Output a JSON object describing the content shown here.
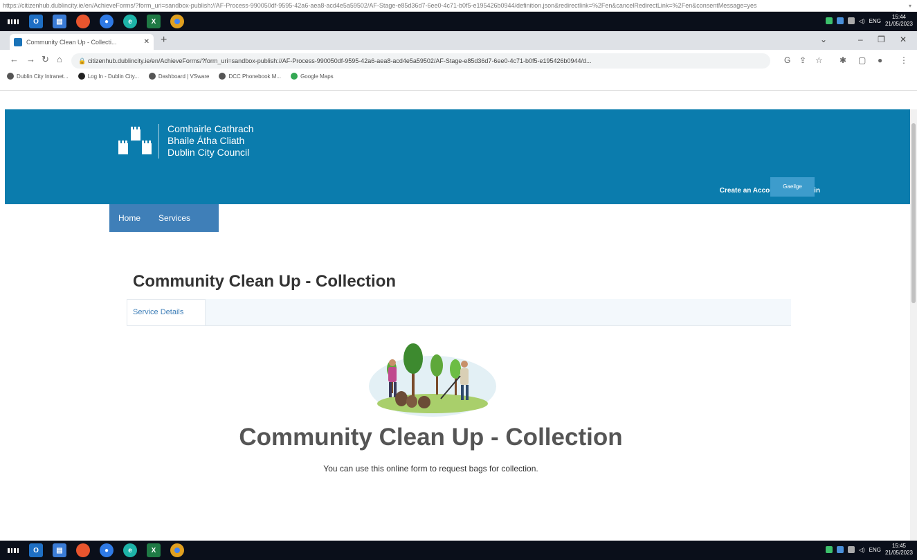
{
  "url_strip": "https://citizenhub.dublincity.ie/en/AchieveForms/?form_uri=sandbox-publish://AF-Process-990050df-9595-42a6-aea8-acd4e5a59502/AF-Stage-e85d36d7-6ee0-4c71-b0f5-e195426b0944/definition.json&redirectlink=%2Fen&cancelRedirectLink=%2Fen&consentMessage=yes",
  "taskbar_top": {
    "date": "21/05/2023",
    "time": "15:44",
    "lang": "ENG"
  },
  "taskbar_bottom": {
    "date": "21/05/2023",
    "time": "15:45",
    "lang": "ENG"
  },
  "browser": {
    "tab_title": "Community Clean Up - Collecti...",
    "address": "citizenhub.dublincity.ie/en/AchieveForms/?form_uri=sandbox-publish://AF-Process-990050df-9595-42a6-aea8-acd4e5a59502/AF-Stage-e85d36d7-6ee0-4c71-b0f5-e195426b0944/d...",
    "bookmarks": [
      "Dublin City Intranet...",
      "Log In - Dublin City...",
      "Dashboard | VSware",
      "DCC Phonebook M...",
      "Google Maps"
    ]
  },
  "header": {
    "logo_lines": [
      "Comhairle Cathrach",
      "Bhaile Átha Cliath",
      "Dublin City Council"
    ],
    "create_account": "Create an Account",
    "login": "Login",
    "gaeilge": "Gaeilge"
  },
  "nav": {
    "home": "Home",
    "services": "Services"
  },
  "main": {
    "page_title": "Community Clean Up - Collection",
    "tab_label": "Service Details",
    "hero_heading": "Community Clean Up - Collection",
    "hero_desc": "You can use this online form to request bags for collection."
  }
}
